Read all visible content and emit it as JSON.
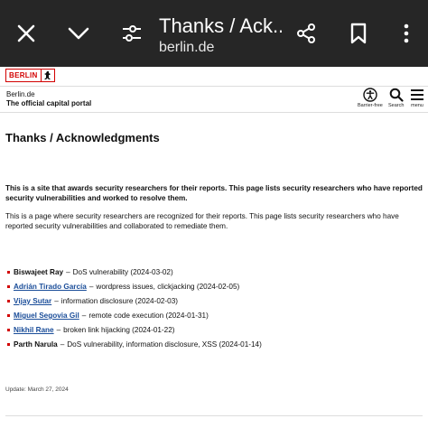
{
  "browser": {
    "title": "Thanks / Ack...",
    "url": "berlin.de"
  },
  "site": {
    "logo_text": "BERLIN",
    "name": "Berlin.de",
    "tagline": "The official capital portal",
    "tools": {
      "barrier_free": "Barrier-free",
      "search": "Search",
      "menu": "menu"
    }
  },
  "page": {
    "heading": "Thanks / Acknowledgments",
    "intro_bold": "This is a site that awards security researchers for their reports. This page lists security researchers who have reported security vulnerabilities and worked to resolve them.",
    "intro": "This is a page where security researchers are recognized for their reports. This page lists security researchers who have reported security vulnerabilities and collaborated to remediate them.",
    "researchers": [
      {
        "name": "Biswajeet Ray",
        "detail": "DoS vulnerability (2024-03-02)",
        "linked": false
      },
      {
        "name": "Adrián Tirado García",
        "detail": "wordpress issues, clickjacking (2024-02-05)",
        "linked": true
      },
      {
        "name": "Vijay Sutar",
        "detail": "information disclosure (2024-02-03)",
        "linked": true
      },
      {
        "name": "Miguel Segovia Gil",
        "detail": "remote code execution (2024-01-31)",
        "linked": true
      },
      {
        "name": "Nikhil Rane",
        "detail": "broken link hijacking (2024-01-22)",
        "linked": true
      },
      {
        "name": "Parth Narula",
        "detail": "DoS vulnerability, information disclosure, XSS (2024-01-14)",
        "linked": false
      }
    ],
    "dash": "–",
    "updated": "Update: March 27, 2024"
  },
  "colors": {
    "appbar": "#262626",
    "brand_red": "#d20000",
    "link": "#1a4d99"
  }
}
